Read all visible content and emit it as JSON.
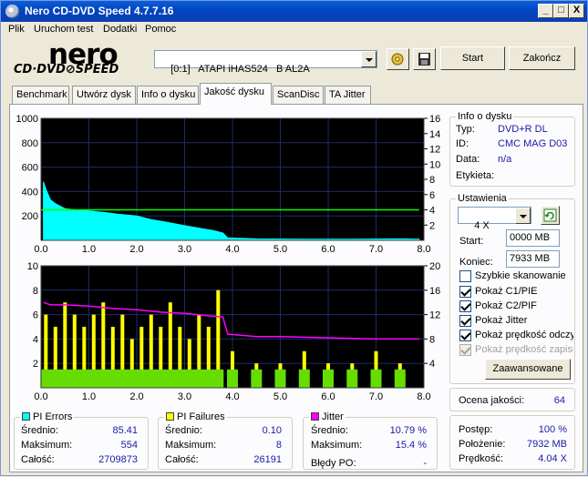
{
  "window": {
    "title": "Nero CD-DVD Speed 4.7.7.16",
    "controls": {
      "minimize": "_",
      "maximize": "□",
      "close": "X"
    }
  },
  "menu": [
    "Plik",
    "Uruchom test",
    "Dodatki",
    "Pomoc"
  ],
  "logo": {
    "brand": "nero",
    "product": "CD·DVD⊘SPEED"
  },
  "drive": {
    "selected": "[0:1]   ATAPI iHAS524   B AL2A"
  },
  "buttons": {
    "start": "Start",
    "end": "Zakończ",
    "advanced": "Zaawansowane"
  },
  "tabs": [
    "Benchmark",
    "Utwórz dysk",
    "Info o dysku",
    "Jakość dysku",
    "ScanDisc",
    "TA Jitter"
  ],
  "active_tab": "Jakość dysku",
  "disc_info": {
    "title": "Info o dysku",
    "rows": [
      {
        "label": "Typ:",
        "value": "DVD+R DL"
      },
      {
        "label": "ID:",
        "value": "CMC MAG D03"
      },
      {
        "label": "Data:",
        "value": "n/a"
      },
      {
        "label": "Etykieta:",
        "value": ""
      }
    ]
  },
  "settings": {
    "title": "Ustawienia",
    "speed": "4 X",
    "start_label": "Start:",
    "start_value": "0000 MB",
    "end_label": "Koniec:",
    "end_value": "7933 MB",
    "checkboxes": [
      {
        "label": "Szybkie skanowanie",
        "checked": false,
        "disabled": false
      },
      {
        "label": "Pokaż C1/PIE",
        "checked": true,
        "disabled": false
      },
      {
        "label": "Pokaż C2/PIF",
        "checked": true,
        "disabled": false
      },
      {
        "label": "Pokaż Jitter",
        "checked": true,
        "disabled": false
      },
      {
        "label": "Pokaż prędkość odczytu",
        "checked": true,
        "disabled": false
      },
      {
        "label": "Pokaż prędkość zapisu",
        "checked": true,
        "disabled": true
      }
    ]
  },
  "quality": {
    "label": "Ocena jakości:",
    "value": "64"
  },
  "progress": {
    "rows": [
      {
        "label": "Postęp:",
        "value": "100 %"
      },
      {
        "label": "Położenie:",
        "value": "7932 MB"
      },
      {
        "label": "Prędkość:",
        "value": "4.04 X"
      }
    ]
  },
  "pi_errors": {
    "title": "PI Errors",
    "color": "#00ffff",
    "rows": [
      {
        "label": "Średnio:",
        "value": "85.41"
      },
      {
        "label": "Maksimum:",
        "value": "554"
      },
      {
        "label": "Całość:",
        "value": "2709873"
      }
    ]
  },
  "pi_failures": {
    "title": "PI Failures",
    "color": "#ffff00",
    "rows": [
      {
        "label": "Średnio:",
        "value": "0.10"
      },
      {
        "label": "Maksimum:",
        "value": "8"
      },
      {
        "label": "Całość:",
        "value": "26191"
      }
    ]
  },
  "jitter": {
    "title": "Jitter",
    "color": "#ff00ff",
    "rows": [
      {
        "label": "Średnio:",
        "value": "10.79 %"
      },
      {
        "label": "Maksimum:",
        "value": "15.4 %"
      }
    ],
    "bledy_po_label": "Błędy PO:",
    "bledy_po_value": "-"
  },
  "chart_data": [
    {
      "type": "area",
      "series": [
        {
          "name": "PI Errors",
          "color": "#00ffff",
          "x": [
            0.05,
            0.1,
            0.2,
            0.3,
            0.5,
            0.7,
            1.0,
            1.3,
            1.6,
            2.0,
            2.3,
            2.6,
            3.0,
            3.3,
            3.6,
            3.8,
            3.9,
            4.5,
            5.5,
            6.5,
            7.5,
            7.9
          ],
          "y": [
            480,
            420,
            330,
            300,
            260,
            250,
            240,
            230,
            215,
            200,
            170,
            150,
            120,
            100,
            80,
            60,
            20,
            12,
            10,
            10,
            12,
            10
          ]
        },
        {
          "name": "Read speed",
          "color": "#00ff00",
          "axis": "right",
          "x": [
            0.0,
            7.9
          ],
          "y": [
            4.0,
            4.0
          ]
        }
      ],
      "x_ticks": [
        "0.0",
        "1.0",
        "2.0",
        "3.0",
        "4.0",
        "5.0",
        "6.0",
        "7.0",
        "8.0"
      ],
      "y_left_ticks": [
        "1000",
        "800",
        "600",
        "400",
        "200"
      ],
      "y_right_ticks": [
        "16",
        "14",
        "12",
        "10",
        "8",
        "6",
        "4",
        "2"
      ],
      "xlim": [
        0,
        8
      ],
      "ylim": [
        0,
        1000
      ],
      "y2lim": [
        0,
        16
      ]
    },
    {
      "type": "bar",
      "series": [
        {
          "name": "PI Failures",
          "color": "#ffff00",
          "x": [
            0.1,
            0.3,
            0.5,
            0.7,
            0.9,
            1.1,
            1.3,
            1.5,
            1.7,
            1.9,
            2.1,
            2.3,
            2.5,
            2.7,
            2.9,
            3.1,
            3.3,
            3.5,
            3.7,
            4.0,
            4.5,
            5.0,
            5.5,
            6.0,
            6.5,
            7.0,
            7.5
          ],
          "y": [
            6,
            5,
            7,
            6,
            5,
            6,
            7,
            5,
            6,
            4,
            5,
            6,
            5,
            7,
            5,
            4,
            6,
            5,
            8,
            3,
            2,
            2,
            3,
            2,
            2,
            3,
            2
          ]
        },
        {
          "name": "Jitter",
          "color": "#ff00ff",
          "axis": "right",
          "x": [
            0.05,
            0.2,
            0.5,
            1.0,
            1.5,
            2.0,
            2.5,
            3.0,
            3.5,
            3.8,
            3.9,
            4.5,
            5.0,
            6.0,
            7.0,
            7.9
          ],
          "y": [
            14.0,
            13.6,
            13.6,
            13.4,
            13.0,
            12.8,
            12.4,
            12.2,
            11.8,
            11.6,
            8.8,
            8.4,
            8.4,
            8.2,
            8.0,
            8.0
          ]
        }
      ],
      "x_ticks": [
        "0.0",
        "1.0",
        "2.0",
        "3.0",
        "4.0",
        "5.0",
        "6.0",
        "7.0",
        "8.0"
      ],
      "y_left_ticks": [
        "10",
        "8",
        "6",
        "4",
        "2"
      ],
      "y_right_ticks": [
        "20",
        "16",
        "12",
        "8",
        "4"
      ],
      "xlim": [
        0,
        8
      ],
      "ylim": [
        0,
        10
      ],
      "y2lim": [
        0,
        20
      ]
    }
  ]
}
